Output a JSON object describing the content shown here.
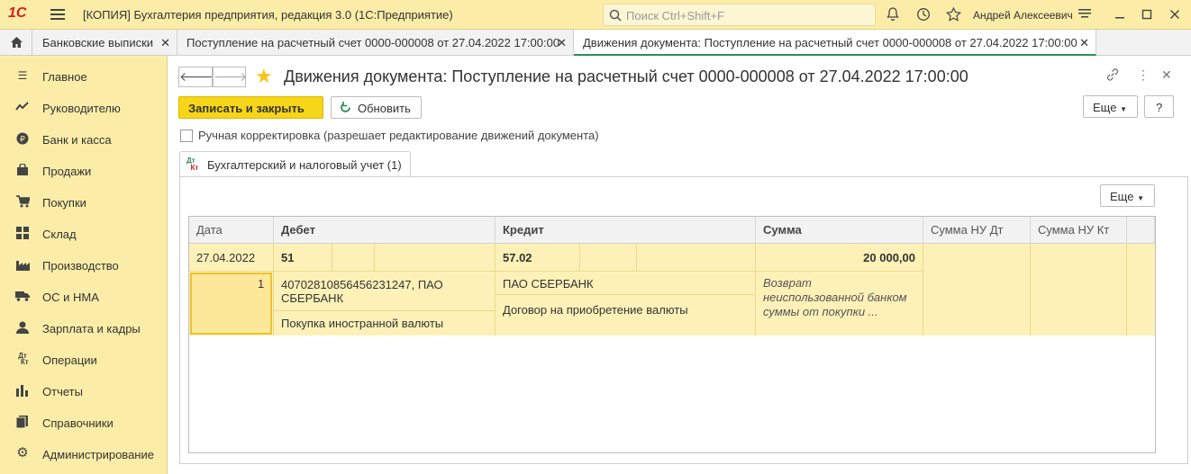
{
  "app": {
    "logo": "1С",
    "title": "[КОПИЯ] Бухгалтерия предприятия, редакция 3.0  (1С:Предприятие)",
    "search_placeholder": "Поиск Ctrl+Shift+F",
    "user": "Андрей Алексеевич"
  },
  "tabs": [
    {
      "label": "Банковские выписки"
    },
    {
      "label": "Поступление на расчетный счет 0000-000008 от 27.04.2022 17:00:00"
    },
    {
      "label": "Движения документа: Поступление на расчетный счет 0000-000008 от 27.04.2022 17:00:00"
    }
  ],
  "sidebar": {
    "items": [
      {
        "label": "Главное",
        "icon": "menu-lines-icon"
      },
      {
        "label": "Руководителю",
        "icon": "trend-icon"
      },
      {
        "label": "Банк и касса",
        "icon": "ruble-coin-icon"
      },
      {
        "label": "Продажи",
        "icon": "shopping-bag-icon"
      },
      {
        "label": "Покупки",
        "icon": "cart-icon"
      },
      {
        "label": "Склад",
        "icon": "warehouse-icon"
      },
      {
        "label": "Производство",
        "icon": "factory-icon"
      },
      {
        "label": "ОС и НМА",
        "icon": "truck-icon"
      },
      {
        "label": "Зарплата и кадры",
        "icon": "person-icon"
      },
      {
        "label": "Операции",
        "icon": "dt-kt-icon"
      },
      {
        "label": "Отчеты",
        "icon": "bar-chart-icon"
      },
      {
        "label": "Справочники",
        "icon": "book-icon"
      },
      {
        "label": "Администрирование",
        "icon": "gear-icon"
      }
    ]
  },
  "form": {
    "title": "Движения документа: Поступление на расчетный счет 0000-000008 от 27.04.2022 17:00:00",
    "save_close": "Записать и закрыть",
    "refresh": "Обновить",
    "more": "Еще",
    "help": "?",
    "manual_edit": "Ручная корректировка (разрешает редактирование движений документа)",
    "tab_label": "Бухгалтерский и налоговый учет (1)",
    "tab_icon_dt": "Дт",
    "tab_icon_kt": "Кт",
    "grid_more": "Еще"
  },
  "table": {
    "headers": [
      "Дата",
      "Дебет",
      "Кредит",
      "Сумма",
      "Сумма НУ Дт",
      "Сумма НУ Кт"
    ],
    "row": {
      "date": "27.04.2022",
      "num": "1",
      "debit_account": "51",
      "debit_sub1_line1": "40702810856456231247, ПАО",
      "debit_sub1_line2": "СБЕРБАНК",
      "debit_sub2": "Покупка иностранной валюты",
      "credit_account": "57.02",
      "credit_sub1": "ПАО СБЕРБАНК",
      "credit_sub2": "Договор на приобретение валюты",
      "amount": "20 000,00",
      "content_line1": "Возврат",
      "content_line2": "неиспользованной банком",
      "content_line3": "суммы от покупки ..."
    }
  },
  "colors": {
    "accent_yellow": "#fbeda8",
    "primary_button": "#f7d619",
    "active_tab_underline": "#2e8b57",
    "row_highlight": "#fdf1b8"
  }
}
